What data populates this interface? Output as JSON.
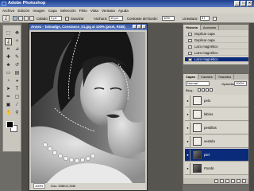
{
  "app": {
    "title": "Adobe Photoshop"
  },
  "menu": [
    "Archivo",
    "Edición",
    "Imagen",
    "Capa",
    "Selección",
    "Filtro",
    "Vista",
    "Ventana",
    "Ayuda"
  ],
  "options": {
    "feather_label": "Calado:",
    "feather_value": "0 px",
    "antialias_label": "Suavizar",
    "width_label": "Anchura:",
    "width_value": "10 px",
    "contrast_label": "Contraste del borde:",
    "contrast_value": "10%",
    "frequency_label": "Lineatura:",
    "frequency_value": "57"
  },
  "document": {
    "title": "Annex - Talmadge, Constance_01.jpg al 100% (pixel, RGB)",
    "zoom": "100%",
    "status": "Doc: 538K/2,26M"
  },
  "history": {
    "tabs": [
      "Historia",
      "Acciones"
    ],
    "items": [
      {
        "label": "Duplicar capa",
        "selected": false
      },
      {
        "label": "Duplicar capa",
        "selected": false
      },
      {
        "label": "Lazo magnético",
        "selected": false
      },
      {
        "label": "Lazo magnético",
        "selected": false
      },
      {
        "label": "Lazo magnético",
        "selected": true
      }
    ]
  },
  "layers": {
    "tabs": [
      "Capas",
      "Canales",
      "Trazados"
    ],
    "blend_mode": "Normal",
    "opacity_label": "Opacidad:",
    "opacity_value": "100%",
    "lock_label": "Bloq.:",
    "items": [
      {
        "name": "pelo",
        "selected": false,
        "italic": false
      },
      {
        "name": "labios",
        "selected": false,
        "italic": false
      },
      {
        "name": "pestillas",
        "selected": false,
        "italic": false
      },
      {
        "name": "vestido",
        "selected": false,
        "italic": false
      },
      {
        "name": "piel",
        "selected": true,
        "italic": false
      },
      {
        "name": "Fondo",
        "selected": false,
        "italic": true
      }
    ]
  },
  "toolbox": {
    "tools": [
      "marquee-icon",
      "move-icon",
      "lasso-icon",
      "magic-wand-icon",
      "crop-icon",
      "slice-icon",
      "healing-icon",
      "brush-icon",
      "stamp-icon",
      "history-brush-icon",
      "eraser-icon",
      "gradient-icon",
      "blur-icon",
      "dodge-icon",
      "path-select-icon",
      "type-icon",
      "pen-icon",
      "shape-icon",
      "notes-icon",
      "eyedropper-icon",
      "hand-icon",
      "zoom-icon"
    ],
    "glyphs": [
      "⬚",
      "✥",
      "ʆ",
      "✧",
      "⌗",
      "⊿",
      "✚",
      "✎",
      "♣",
      "↺",
      "▭",
      "▤",
      "◔",
      "◕",
      "➤",
      "T",
      "✒",
      "▢",
      "▣",
      "⁄",
      "✋",
      "⚲"
    ]
  }
}
